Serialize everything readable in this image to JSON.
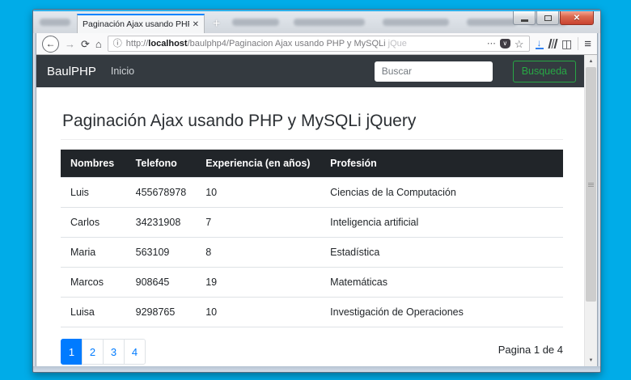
{
  "colors": {
    "desktop": "#00ace8",
    "navbar_bg": "#343a40",
    "table_header_bg": "#212529",
    "accent_blue": "#007bff",
    "success_green": "#28a745",
    "tab_accent": "#0a84ff",
    "download_blue": "#2e7ff0"
  },
  "browser": {
    "tab": {
      "title": "Paginación Ajax usando PHP y MyS",
      "close_glyph": "✕",
      "new_tab_glyph": "+"
    },
    "toolbar": {
      "back_glyph": "←",
      "forward_glyph": "→",
      "reload_glyph": "⟳",
      "home_glyph": "⌂",
      "info_glyph": "ⓘ",
      "url_prefix": "http://",
      "url_host": "localhost",
      "url_path": "/baulphp4/Paginacion Ajax usando PHP y MySQLi ",
      "url_tail": "jQue",
      "ellipsis_glyph": "⋯",
      "pocket_glyph": "∨",
      "star_glyph": "☆",
      "menu_glyph": "≡",
      "sidebar_glyph": "◫"
    },
    "window_controls": {
      "close_glyph": "✕"
    },
    "scrollbar": {
      "up_glyph": "▲",
      "down_glyph": "▼"
    }
  },
  "page": {
    "navbar": {
      "brand": "BaulPHP",
      "links": [
        {
          "label": "Inicio"
        }
      ],
      "search_placeholder": "Buscar",
      "search_button": "Busqueda"
    },
    "heading": "Paginación Ajax usando PHP y MySQLi jQuery",
    "table": {
      "headers": [
        "Nombres",
        "Telefono",
        "Experiencia (en años)",
        "Profesión"
      ],
      "rows": [
        [
          "Luis",
          "455678978",
          "10",
          "Ciencias de la Computación"
        ],
        [
          "Carlos",
          "34231908",
          "7",
          "Inteligencia artificial"
        ],
        [
          "Maria",
          "563109",
          "8",
          "Estadística"
        ],
        [
          "Marcos",
          "908645",
          "19",
          "Matemáticas"
        ],
        [
          "Luisa",
          "9298765",
          "10",
          "Investigación de Operaciones"
        ]
      ]
    },
    "pagination": {
      "pages": [
        "1",
        "2",
        "3",
        "4"
      ],
      "active_index": 0,
      "status": "Pagina 1 de 4"
    }
  }
}
